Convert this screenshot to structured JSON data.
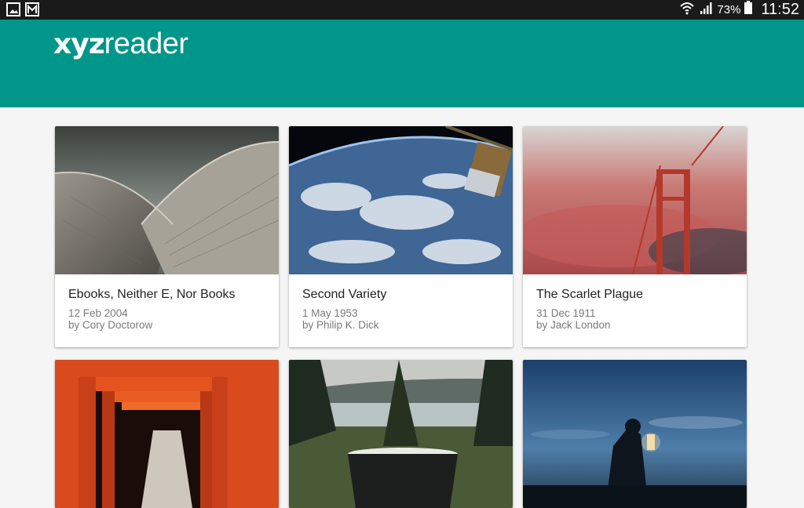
{
  "app": {
    "logo_bold": "xyz",
    "logo_light": "reader",
    "colors": {
      "primary": "#00968a",
      "statusbar": "#1a1a1a"
    }
  },
  "statusbar": {
    "left_icons": [
      "gallery-notification-icon",
      "gmail-notification-icon"
    ],
    "right_icons": [
      "wifi-icon",
      "signal-icon",
      "battery-icon"
    ],
    "battery": "73%",
    "time": "11:52"
  },
  "articles": [
    {
      "title": "Ebooks, Neither E, Nor Books",
      "date": "12 Feb 2004",
      "author": "by Cory Doctorow",
      "image": "opera-house-roof"
    },
    {
      "title": "Second Variety",
      "date": "1 May 1953",
      "author": "by Philip K. Dick",
      "image": "earth-from-space"
    },
    {
      "title": "The Scarlet Plague",
      "date": "31 Dec 1911",
      "author": "by Jack London",
      "image": "bridge-in-red-fog"
    },
    {
      "title": "",
      "date": "",
      "author": "",
      "image": "red-torii-gates"
    },
    {
      "title": "",
      "date": "",
      "author": "",
      "image": "forest-lake-mug"
    },
    {
      "title": "",
      "date": "",
      "author": "",
      "image": "lantern-at-dusk"
    }
  ]
}
